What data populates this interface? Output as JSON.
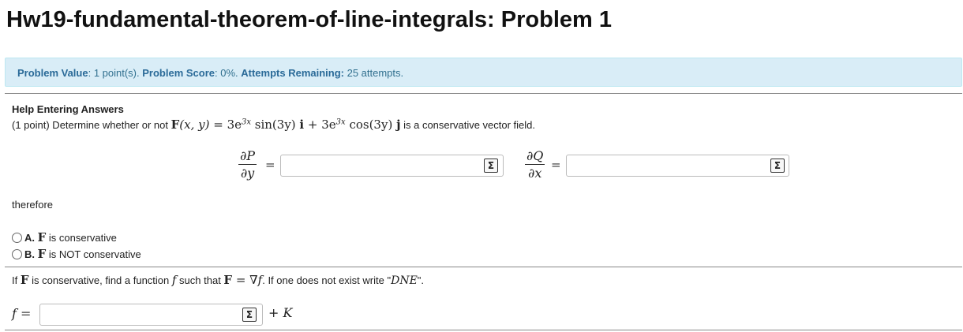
{
  "title": "Hw19-fundamental-theorem-of-line-integrals: Problem 1",
  "info": {
    "value_label": "Problem Value",
    "value_text": ": 1 point(s). ",
    "score_label": "Problem Score",
    "score_text": ": 0%. ",
    "attempts_label": "Attempts Remaining:",
    "attempts_text": " 25 attempts."
  },
  "help_link": "Help Entering Answers",
  "question": {
    "prefix": "(1 point) Determine whether or not ",
    "F": "F",
    "args": "(x, y)",
    "eq": " = ",
    "expr": "3e",
    "exp1": "3x",
    "sin": " sin(3y) ",
    "i": "i",
    "plus": " + 3e",
    "exp2": "3x",
    "cos": " cos(3y) ",
    "j": "j",
    "suffix": " is a conservative vector field."
  },
  "partials": {
    "p_num": "∂P",
    "p_den": "∂y",
    "q_num": "∂Q",
    "q_den": "∂x",
    "equals": "=",
    "p_value": "",
    "q_value": ""
  },
  "therefore": "therefore",
  "options": [
    {
      "letter": "A.",
      "F": "F",
      "text": " is conservative"
    },
    {
      "letter": "B.",
      "F": "F",
      "text": " is NOT conservative"
    }
  ],
  "part2": {
    "prefix": "If ",
    "F": "F",
    "mid": " is conservative, find a function ",
    "f": "f",
    "mid2": " such that ",
    "F2": "F",
    "eq": " = ∇",
    "f2": "f",
    "mid3": ". If one does not exist write \"",
    "dne": "DNE",
    "suffix": "\"."
  },
  "final": {
    "f_label": "f",
    "equals": " =",
    "plus_k": "+ K",
    "value": ""
  },
  "sigma_symbol": "Σ"
}
